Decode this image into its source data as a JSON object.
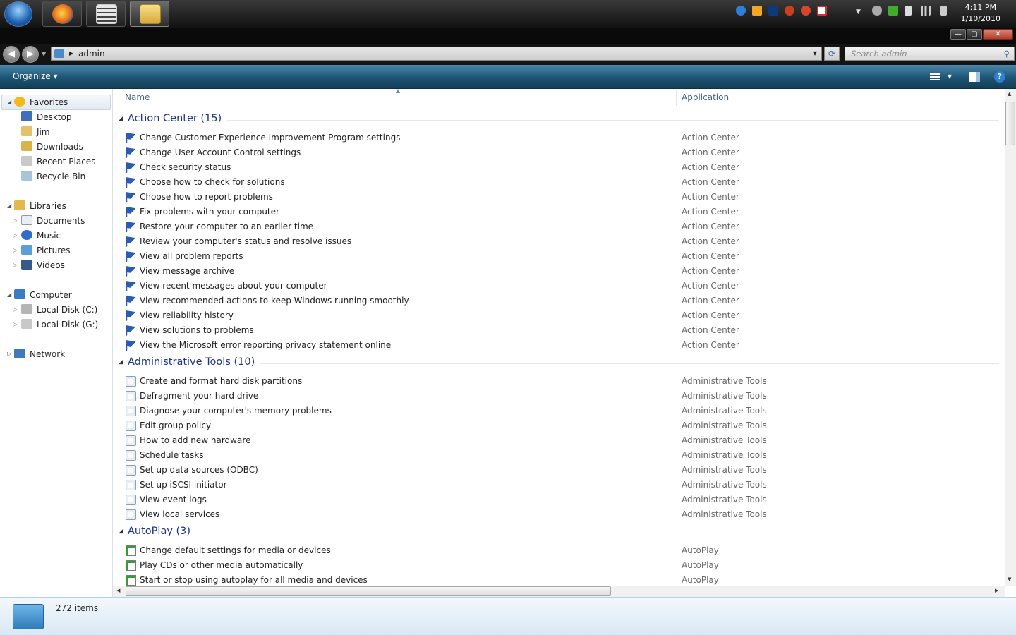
{
  "taskbar": {
    "clock_time": "4:11 PM",
    "clock_date": "1/10/2010",
    "apps": [
      {
        "icon": "firefox-icon"
      },
      {
        "icon": "calculator-icon"
      },
      {
        "icon": "explorer-folder-icon"
      }
    ]
  },
  "window_controls": {
    "minimize": "—",
    "maximize": "▢",
    "close": "✕"
  },
  "address": {
    "path": "admin",
    "search_placeholder": "Search admin"
  },
  "command_bar": {
    "organize": "Organize ▾"
  },
  "nav": {
    "favorites": {
      "label": "Favorites",
      "items": [
        "Desktop",
        "Jim",
        "Downloads",
        "Recent Places",
        "Recycle Bin"
      ]
    },
    "libraries": {
      "label": "Libraries",
      "items": [
        "Documents",
        "Music",
        "Pictures",
        "Videos"
      ]
    },
    "computer": {
      "label": "Computer",
      "items": [
        "Local Disk (C:)",
        "Local Disk (G:)"
      ]
    },
    "network": {
      "label": "Network"
    }
  },
  "columns": {
    "name": "Name",
    "application": "Application"
  },
  "groups": [
    {
      "title": "Action Center (15)",
      "items": [
        {
          "name": "Change Customer Experience Improvement Program settings",
          "app": "Action Center"
        },
        {
          "name": "Change User Account Control settings",
          "app": "Action Center"
        },
        {
          "name": "Check security status",
          "app": "Action Center"
        },
        {
          "name": "Choose how to check for solutions",
          "app": "Action Center"
        },
        {
          "name": "Choose how to report problems",
          "app": "Action Center"
        },
        {
          "name": "Fix problems with your computer",
          "app": "Action Center"
        },
        {
          "name": "Restore your computer to an earlier time",
          "app": "Action Center"
        },
        {
          "name": "Review your computer's status and resolve issues",
          "app": "Action Center"
        },
        {
          "name": "View all problem reports",
          "app": "Action Center"
        },
        {
          "name": "View message archive",
          "app": "Action Center"
        },
        {
          "name": "View recent messages about your computer",
          "app": "Action Center"
        },
        {
          "name": "View recommended actions to keep Windows running smoothly",
          "app": "Action Center"
        },
        {
          "name": "View reliability history",
          "app": "Action Center"
        },
        {
          "name": "View solutions to problems",
          "app": "Action Center"
        },
        {
          "name": "View the Microsoft error reporting privacy statement online",
          "app": "Action Center"
        }
      ]
    },
    {
      "title": "Administrative Tools (10)",
      "items": [
        {
          "name": "Create and format hard disk partitions",
          "app": "Administrative Tools"
        },
        {
          "name": "Defragment your hard drive",
          "app": "Administrative Tools"
        },
        {
          "name": "Diagnose your computer's memory problems",
          "app": "Administrative Tools"
        },
        {
          "name": "Edit group policy",
          "app": "Administrative Tools"
        },
        {
          "name": "How to add new hardware",
          "app": "Administrative Tools"
        },
        {
          "name": "Schedule tasks",
          "app": "Administrative Tools"
        },
        {
          "name": "Set up data sources (ODBC)",
          "app": "Administrative Tools"
        },
        {
          "name": "Set up iSCSI initiator",
          "app": "Administrative Tools"
        },
        {
          "name": "View event logs",
          "app": "Administrative Tools"
        },
        {
          "name": "View local services",
          "app": "Administrative Tools"
        }
      ]
    },
    {
      "title": "AutoPlay (3)",
      "items": [
        {
          "name": "Change default settings for media or devices",
          "app": "AutoPlay"
        },
        {
          "name": "Play CDs or other media automatically",
          "app": "AutoPlay"
        },
        {
          "name": "Start or stop using autoplay for all media and devices",
          "app": "AutoPlay"
        }
      ]
    }
  ],
  "details": {
    "count": "272 items"
  },
  "colors": {
    "group_title": "#1e3287",
    "cmdbar": "#1d5473",
    "flag": "#1f4e9c"
  }
}
